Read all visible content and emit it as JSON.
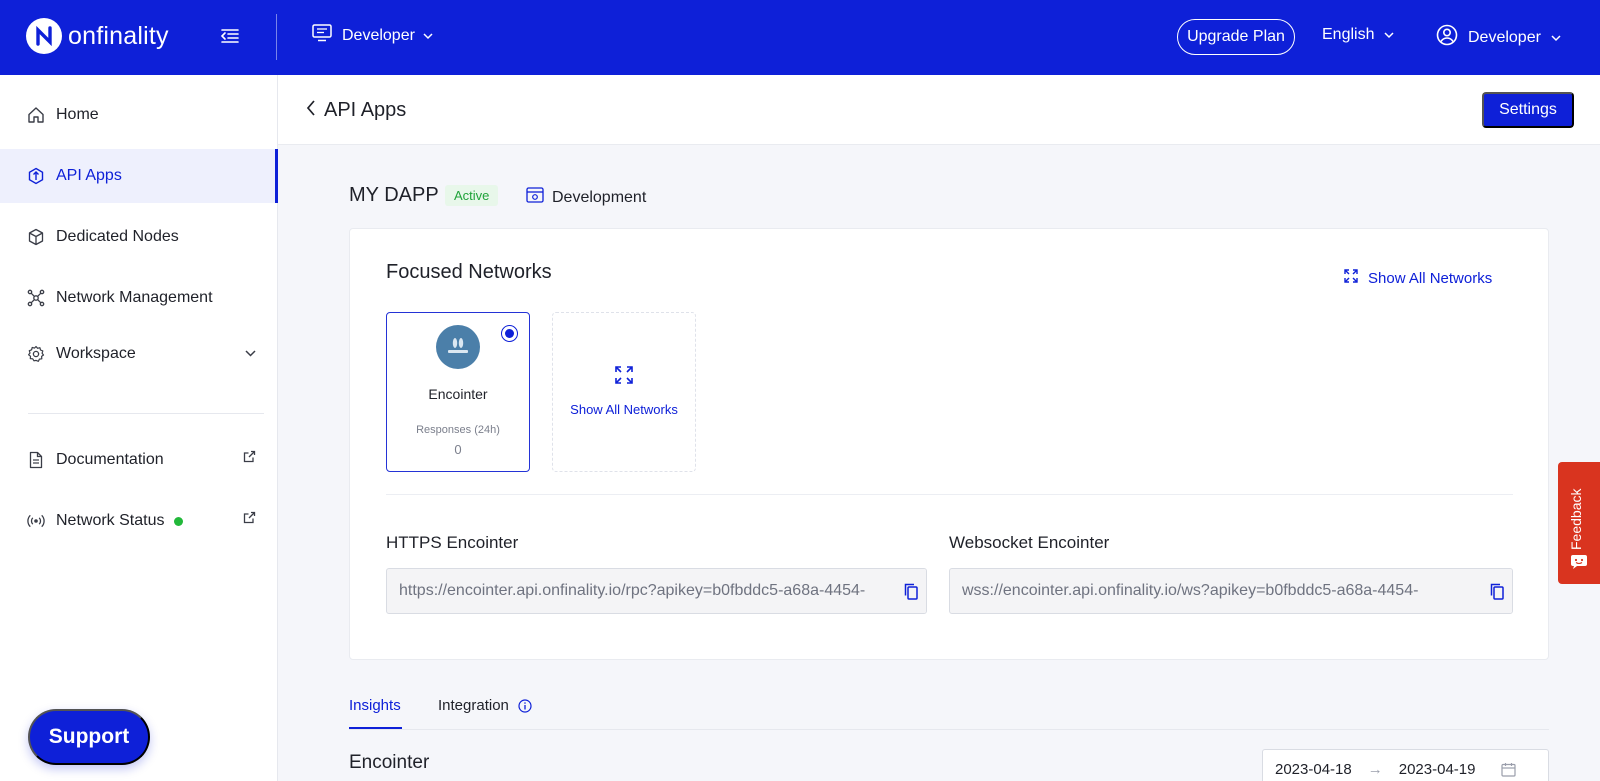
{
  "topbar": {
    "logo_text": "onfinality",
    "workspace_label": "Developer",
    "upgrade_label": "Upgrade Plan",
    "language_label": "English",
    "user_label": "Developer",
    "brand_color": "#0e20d8"
  },
  "sidebar": {
    "items": [
      {
        "label": "Home",
        "icon": "home-icon"
      },
      {
        "label": "API Apps",
        "icon": "api-apps-icon",
        "active": true
      },
      {
        "label": "Dedicated Nodes",
        "icon": "cube-icon"
      },
      {
        "label": "Network Management",
        "icon": "network-icon"
      },
      {
        "label": "Workspace",
        "icon": "gear-icon"
      },
      {
        "label": "Documentation",
        "icon": "document-icon"
      },
      {
        "label": "Network Status",
        "icon": "broadcast-icon",
        "status_color": "#22b83a"
      }
    ],
    "support_label": "Support"
  },
  "header": {
    "title": "API Apps",
    "settings_label": "Settings"
  },
  "app": {
    "name": "MY DAPP",
    "status": "Active",
    "environment": "Development"
  },
  "focused_networks": {
    "title": "Focused Networks",
    "show_all_label": "Show All Networks",
    "network": {
      "name": "Encointer",
      "responses_label": "Responses (24h)",
      "responses_value": "0"
    },
    "show_all_tile_label": "Show All Networks"
  },
  "endpoints": {
    "https": {
      "label": "HTTPS Encointer",
      "value": "https://encointer.api.onfinality.io/rpc?apikey=b0fbddc5-a68a-4454-"
    },
    "websocket": {
      "label": "Websocket Encointer",
      "value": "wss://encointer.api.onfinality.io/ws?apikey=b0fbddc5-a68a-4454-"
    }
  },
  "tabs": [
    {
      "label": "Insights",
      "active": true
    },
    {
      "label": "Integration"
    }
  ],
  "insights": {
    "section_title": "Encointer",
    "date_from": "2023-04-18",
    "date_to": "2023-04-19"
  },
  "feedback": {
    "label": "Feedback"
  }
}
